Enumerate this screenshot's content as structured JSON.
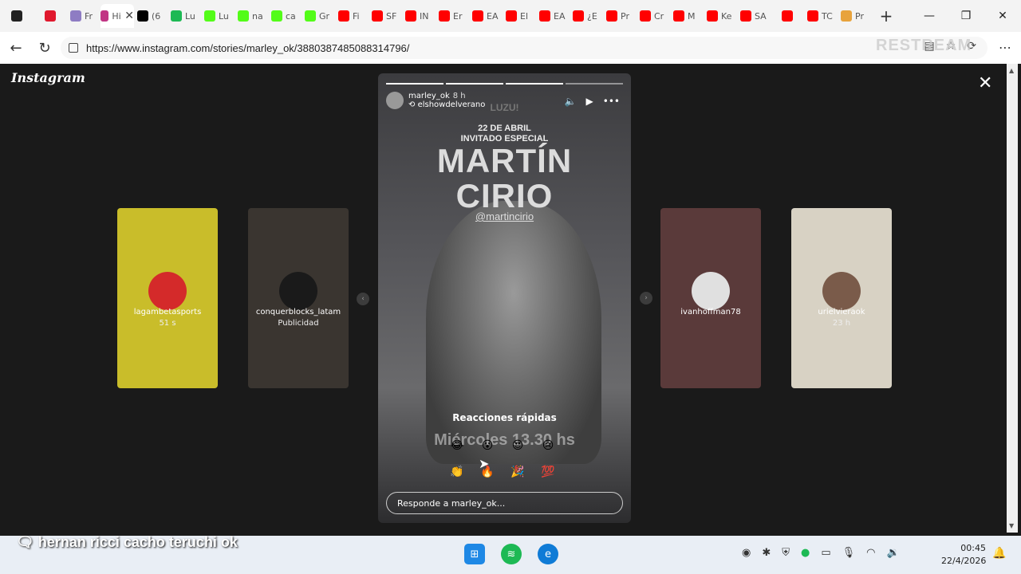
{
  "tabs": [
    {
      "icon": "record-icon",
      "color": "#222222",
      "label": ""
    },
    {
      "icon": "circle-icon",
      "color": "#e0182d",
      "label": ""
    },
    {
      "icon": "app-icon",
      "color": "#8e7cc3",
      "label": "Fr"
    },
    {
      "icon": "instagram-icon",
      "color": "#c13584",
      "label": "Hi",
      "active": true
    },
    {
      "icon": "x-icon",
      "color": "#000000",
      "label": "(6"
    },
    {
      "icon": "k-icon",
      "color": "#1db954",
      "label": "Lu"
    },
    {
      "icon": "k-icon",
      "color": "#53fc18",
      "label": "Lu"
    },
    {
      "icon": "k-icon",
      "color": "#53fc18",
      "label": "na"
    },
    {
      "icon": "k-icon",
      "color": "#53fc18",
      "label": "ca"
    },
    {
      "icon": "k-icon",
      "color": "#53fc18",
      "label": "Gr"
    },
    {
      "icon": "youtube-icon",
      "color": "#ff0000",
      "label": "Fi"
    },
    {
      "icon": "youtube-icon",
      "color": "#ff0000",
      "label": "SF"
    },
    {
      "icon": "youtube-icon",
      "color": "#ff0000",
      "label": "IN"
    },
    {
      "icon": "youtube-icon",
      "color": "#ff0000",
      "label": "Er"
    },
    {
      "icon": "youtube-icon",
      "color": "#ff0000",
      "label": "EA"
    },
    {
      "icon": "youtube-icon",
      "color": "#ff0000",
      "label": "El"
    },
    {
      "icon": "youtube-icon",
      "color": "#ff0000",
      "label": "EA"
    },
    {
      "icon": "youtube-icon",
      "color": "#ff0000",
      "label": "¿E"
    },
    {
      "icon": "youtube-icon",
      "color": "#ff0000",
      "label": "Pr"
    },
    {
      "icon": "youtube-icon",
      "color": "#ff0000",
      "label": "Cr"
    },
    {
      "icon": "youtube-icon",
      "color": "#ff0000",
      "label": "M"
    },
    {
      "icon": "youtube-icon",
      "color": "#ff0000",
      "label": "Ke"
    },
    {
      "icon": "youtube-icon",
      "color": "#ff0000",
      "label": "SA"
    },
    {
      "icon": "youtube-icon",
      "color": "#ff0000",
      "label": ""
    },
    {
      "icon": "youtube-icon",
      "color": "#ff0000",
      "label": "TC"
    },
    {
      "icon": "copilot-icon",
      "color": "#e8a33c",
      "label": "Pr"
    }
  ],
  "url": "https://www.instagram.com/stories/marley_ok/3880387485088314796/",
  "watermark": "RESTREAM",
  "instagram_logo": "Instagram",
  "stories_left": [
    {
      "username": "lagambetasports",
      "meta": "51 s",
      "bg": "#c9bd2a",
      "avatar_bg": "#d42a2a"
    },
    {
      "username": "conquerblocks_latam",
      "meta": "Publicidad",
      "bg": "#3a3530",
      "avatar_bg": "#1a1a1a"
    }
  ],
  "stories_right": [
    {
      "username": "ivanhoffman78",
      "meta": "",
      "bg": "#5a3a3a",
      "avatar_bg": "#e0e0e0"
    },
    {
      "username": "urielvieraok",
      "meta": "23 h",
      "bg": "#d8d2c4",
      "avatar_bg": "#7a5b4a"
    }
  ],
  "story": {
    "username": "marley_ok",
    "time": "8 h",
    "reposted_from": "elshowdelverano",
    "top_text": "LUZU!",
    "date": "22 DE ABRIL",
    "guest_label": "INVITADO ESPECIAL",
    "name_line1": "MARTÍN",
    "name_line2": "CIRIO",
    "handle": "@martincirio",
    "schedule": "Miércoles 13.30 hs",
    "reactions_title": "Reacciones rápidas",
    "emojis_row1": [
      "😂",
      "😮",
      "😍",
      "😢"
    ],
    "emojis_row2": [
      "👏",
      "🔥",
      "🎉",
      "💯"
    ],
    "reply_placeholder": "Responde a marley_ok..."
  },
  "caption": "hernan ricci cacho teruchi ok",
  "clock": {
    "time": "00:45",
    "date": "22/4/2026"
  }
}
